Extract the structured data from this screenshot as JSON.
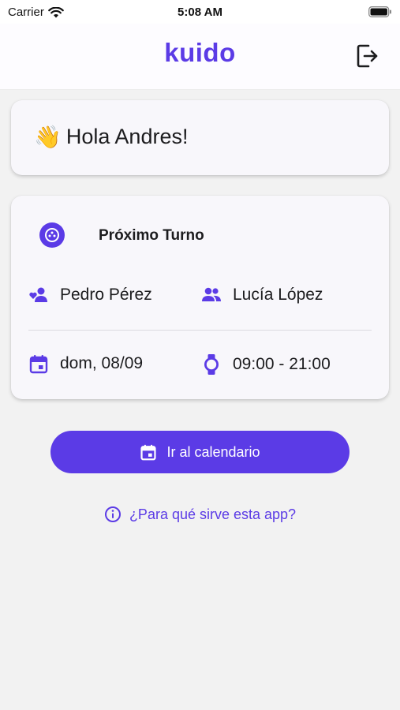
{
  "status_bar": {
    "carrier": "Carrier",
    "time": "5:08 AM"
  },
  "header": {
    "logo": "kuido",
    "logout_icon": "logout-icon"
  },
  "greeting": {
    "emoji": "👋",
    "text": "Hola Andres!"
  },
  "shift": {
    "title": "Próximo Turno",
    "patient": "Pedro Pérez",
    "caregiver": "Lucía López",
    "date": "dom, 08/09",
    "hours": "09:00 - 21:00"
  },
  "actions": {
    "calendar_button": "Ir al calendario",
    "help_link": "¿Para qué sirve esta app?"
  },
  "colors": {
    "accent": "#5b3be6",
    "background": "#f2f2f2",
    "card": "#f8f7fb"
  }
}
